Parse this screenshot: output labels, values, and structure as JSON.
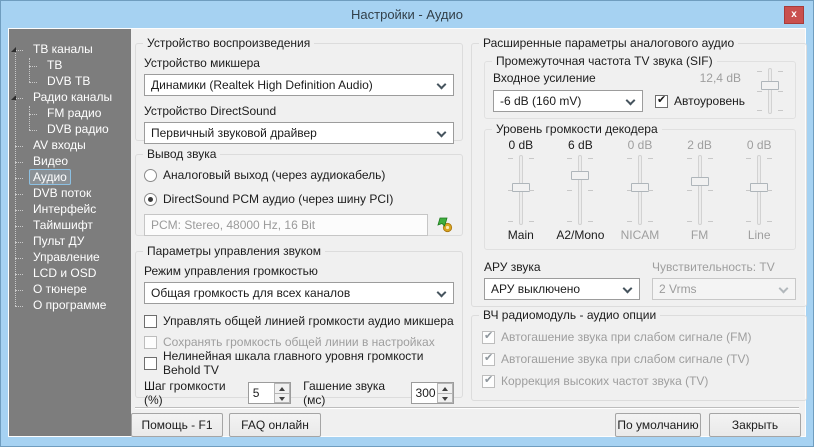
{
  "window": {
    "title": "Настройки - Аудио",
    "close_glyph": "x"
  },
  "colors": {
    "titlebar": "#a6d2f2",
    "close_button": "#c9504e",
    "sidebar_bg": "#7d7d7d",
    "selection_border": "#8cc0e2",
    "dialog_bg": "#f0f0f0"
  },
  "sidebar": {
    "items": [
      "ТВ каналы",
      "ТВ",
      "DVB ТВ",
      "Радио каналы",
      "FM радио",
      "DVB радио",
      "AV входы",
      "Видео",
      "Аудио",
      "DVB поток",
      "Интерфейс",
      "Таймшифт",
      "Пульт ДУ",
      "Управление",
      "LCD и OSD",
      "О тюнере",
      "О программе"
    ],
    "selected": "Аудио"
  },
  "playback": {
    "group_title": "Устройство воспроизведения",
    "mixer_label": "Устройство микшера",
    "mixer_value": "Динамики (Realtek High Definition Audio)",
    "directsound_label": "Устройство DirectSound",
    "directsound_value": "Первичный звуковой драйвер"
  },
  "output": {
    "group_title": "Вывод звука",
    "radio_analog": "Аналоговый выход (через аудиокабель)",
    "radio_pcm": "DirectSound PCM аудио (через шину PCI)",
    "pcm_info": "PCM: Stereo, 48000 Hz, 16 Bit"
  },
  "volume_control": {
    "group_title": "Параметры управления звуком",
    "mode_label": "Режим управления громкостью",
    "mode_value": "Общая громкость для всех каналов",
    "cb_mixer_line": "Управлять общей линией громкости аудио микшера",
    "cb_save_line": "Сохранять громкость общей линии в настройках",
    "cb_nonlinear": "Нелинейная шкала главного уровня громкости Behold TV",
    "step_label": "Шаг громкости (%)",
    "step_value": "5",
    "mute_label": "Гашение звука (мс)",
    "mute_value": "300"
  },
  "advanced": {
    "group_title": "Расширенные параметры аналогового аудио",
    "sif": {
      "group_title": "Промежуточная частота TV звука (SIF)",
      "gain_label": "Входное усиление",
      "gain_value": "-6 dB (160 mV)",
      "autolevel_label": "Автоуровень",
      "autolevel_checked": true,
      "level_value": "12,4 dB"
    },
    "decoder": {
      "group_title": "Уровень громкости декодера",
      "values": [
        "0 dB",
        "6 dB",
        "0 dB",
        "2 dB",
        "0 dB"
      ],
      "names": [
        "Main",
        "A2/Mono",
        "NICAM",
        "FM",
        "Line"
      ],
      "enabled": [
        true,
        true,
        false,
        false,
        false
      ]
    },
    "agc_label": "АРУ звука",
    "agc_value": "АРУ выключено",
    "sensitivity_label": "Чувствительность: TV",
    "sensitivity_value": "2 Vrms"
  },
  "rf_module": {
    "group_title": "ВЧ радиомодуль - аудио опции",
    "items": [
      "Автогашение звука при слабом сигнале (FM)",
      "Автогашение звука при слабом сигнале (TV)",
      "Коррекция высоких частот звука (TV)"
    ],
    "all_checked": true,
    "all_disabled": true
  },
  "footer": {
    "help": "Помощь - F1",
    "faq": "FAQ онлайн",
    "defaults": "По умолчанию",
    "close": "Закрыть"
  }
}
